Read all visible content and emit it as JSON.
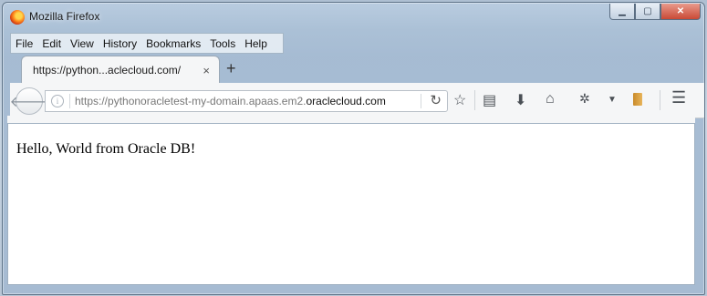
{
  "window": {
    "title": "Mozilla Firefox"
  },
  "menubar": {
    "items": [
      {
        "label": "File"
      },
      {
        "label": "Edit"
      },
      {
        "label": "View"
      },
      {
        "label": "History"
      },
      {
        "label": "Bookmarks"
      },
      {
        "label": "Tools"
      },
      {
        "label": "Help"
      }
    ]
  },
  "tab": {
    "label": "https://python...aclecloud.com/",
    "close": "×"
  },
  "new_tab": "+",
  "urlbar": {
    "prefix": "https://pythonoracletest-my-domain.apaas.em2.",
    "domain": "oraclecloud.com"
  },
  "page": {
    "body_text": "Hello, World from Oracle DB!"
  },
  "icons": {
    "back": "arrow-left-icon",
    "info": "info-icon",
    "reload": "reload-icon",
    "bookmark": "star-icon",
    "reading_list": "reader-icon",
    "download": "download-icon",
    "home": "home-icon",
    "extension": "extension-icon",
    "library": "book-icon",
    "menu": "hamburger-icon"
  },
  "colors": {
    "close_button": "#c94a36",
    "window_frame": "#aac0d6"
  }
}
